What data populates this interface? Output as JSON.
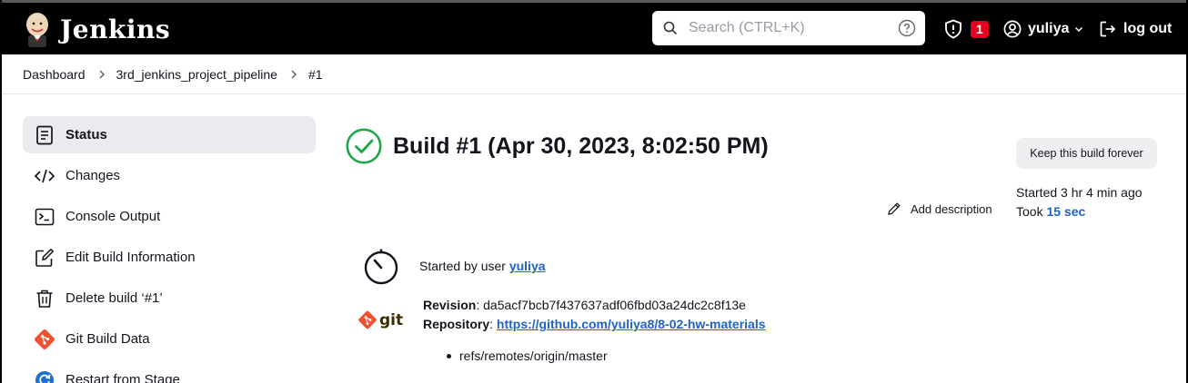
{
  "header": {
    "brand": "Jenkins",
    "search_placeholder": "Search (CTRL+K)",
    "security_count": "1",
    "user_name": "yuliya",
    "logout_label": "log out"
  },
  "breadcrumb": {
    "items": [
      "Dashboard",
      "3rd_jenkins_project_pipeline",
      "#1"
    ]
  },
  "sidebar": {
    "items": [
      {
        "label": "Status",
        "icon": "status-icon",
        "active": true
      },
      {
        "label": "Changes",
        "icon": "code-icon"
      },
      {
        "label": "Console Output",
        "icon": "terminal-icon"
      },
      {
        "label": "Edit Build Information",
        "icon": "edit-icon"
      },
      {
        "label": "Delete build ‘#1’",
        "icon": "trash-icon"
      },
      {
        "label": "Git Build Data",
        "icon": "git-icon"
      },
      {
        "label": "Restart from Stage",
        "icon": "restart-icon"
      }
    ]
  },
  "main": {
    "title": "Build #1 (Apr 30, 2023, 8:02:50 PM)",
    "keep_button": "Keep this build forever",
    "add_description": "Add description",
    "started_ago": "Started 3 hr 4 min ago",
    "took_prefix": "Took",
    "took_value": "15 sec",
    "cause_prefix": "Started by user",
    "cause_user": "yuliya",
    "revision_label": "Revision",
    "revision_value": ": da5acf7bcb7f437637adf06fbd03a24dc2c8f13e",
    "repository_label": "Repository",
    "repository_sep": ": ",
    "repository_url": "https://github.com/yuliya8/8-02-hw-materials",
    "ref": "refs/remotes/origin/master"
  },
  "colors": {
    "header_bg": "#000000",
    "success": "#1ea64b",
    "link": "#1f63c4",
    "badge": "#e6001f",
    "git": "#f05133"
  }
}
